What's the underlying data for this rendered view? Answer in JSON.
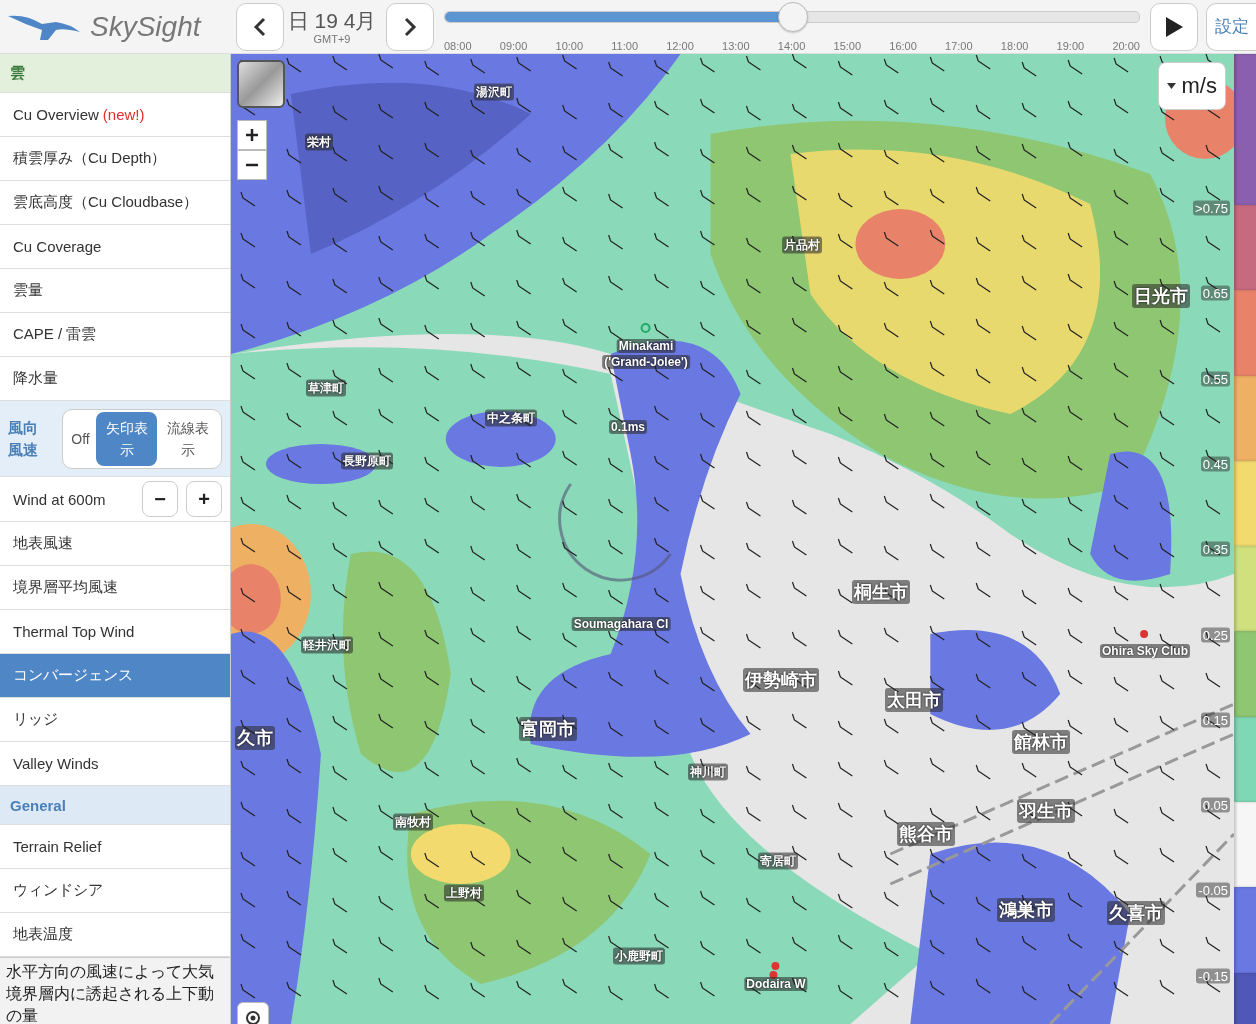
{
  "header": {
    "logo": "SkySight",
    "date": "日 19 4月",
    "timezone": "GMT+9",
    "settings": "設定",
    "timeline": {
      "level": 0.5,
      "ticks": [
        "08:00",
        "09:00",
        "10:00",
        "11:00",
        "12:00",
        "13:00",
        "14:00",
        "15:00",
        "16:00",
        "17:00",
        "18:00",
        "19:00",
        "20:00"
      ]
    }
  },
  "sidebar": {
    "items": [
      {
        "kind": "section",
        "label": "雲",
        "color": "#e2f0dc"
      },
      {
        "kind": "item",
        "label": "Cu Overview",
        "tag": "(new!)",
        "selected": false
      },
      {
        "kind": "item",
        "label": "積雲厚み（Cu Depth）",
        "selected": false
      },
      {
        "kind": "item",
        "label": "雲底高度（Cu Cloudbase）",
        "selected": false
      },
      {
        "kind": "item",
        "label": "Cu Coverage",
        "selected": false
      },
      {
        "kind": "item",
        "label": "雲量",
        "selected": false
      },
      {
        "kind": "item",
        "label": "CAPE / 雷雲",
        "selected": false
      },
      {
        "kind": "item",
        "label": "降水量",
        "selected": false
      },
      {
        "kind": "toggle",
        "label": "風向風速",
        "options": [
          {
            "label": "Off",
            "selected": false
          },
          {
            "label": "矢印表示",
            "selected": true
          },
          {
            "label": "流線表示",
            "selected": false
          }
        ]
      },
      {
        "kind": "stepper",
        "label": "Wind at 600m",
        "minus": "−",
        "plus": "+"
      },
      {
        "kind": "item",
        "label": "地表風速",
        "selected": false
      },
      {
        "kind": "item",
        "label": "境界層平均風速",
        "selected": false
      },
      {
        "kind": "item",
        "label": "Thermal Top Wind",
        "selected": false
      },
      {
        "kind": "item",
        "label": "コンバージェンス",
        "selected": true
      },
      {
        "kind": "item",
        "label": "リッジ",
        "selected": false
      },
      {
        "kind": "item",
        "label": "Valley Winds",
        "selected": false
      },
      {
        "kind": "section",
        "label": "General",
        "color": "#dde9f5"
      },
      {
        "kind": "item",
        "label": "Terrain Relief",
        "selected": false
      },
      {
        "kind": "item",
        "label": "ウィンドシア",
        "selected": false
      },
      {
        "kind": "item",
        "label": "地表温度",
        "selected": false
      }
    ],
    "description": "水平方向の風速によって大気境界層内に誘起される上下動の量"
  },
  "map": {
    "unit": "m/s",
    "labels": [
      {
        "kind": "town",
        "text": "湯沢町"
      },
      {
        "kind": "town",
        "text": "栄村"
      },
      {
        "kind": "town",
        "text": "片品村"
      },
      {
        "kind": "city",
        "text": "日光市"
      },
      {
        "kind": "town",
        "text": "Minakami"
      },
      {
        "kind": "town",
        "text": "('Grand-Jolee')"
      },
      {
        "kind": "town",
        "text": "草津町"
      },
      {
        "kind": "town",
        "text": "中之条町"
      },
      {
        "kind": "town",
        "text": "0.1ms"
      },
      {
        "kind": "town",
        "text": "長野原町"
      },
      {
        "kind": "city",
        "text": "桐生市"
      },
      {
        "kind": "city",
        "text": "伊勢崎市"
      },
      {
        "kind": "city",
        "text": "太田市"
      },
      {
        "kind": "city",
        "text": "館林市"
      },
      {
        "kind": "town",
        "text": "軽井沢町"
      },
      {
        "kind": "city",
        "text": "富岡市"
      },
      {
        "kind": "city",
        "text": "久市"
      },
      {
        "kind": "town",
        "text": "神川町"
      },
      {
        "kind": "city",
        "text": "羽生市"
      },
      {
        "kind": "city",
        "text": "熊谷市"
      },
      {
        "kind": "town",
        "text": "南牧村"
      },
      {
        "kind": "town",
        "text": "寄居町"
      },
      {
        "kind": "town",
        "text": "上野村"
      },
      {
        "kind": "city",
        "text": "鴻巣市"
      },
      {
        "kind": "city",
        "text": "久喜市"
      },
      {
        "kind": "town",
        "text": "小鹿野町"
      },
      {
        "kind": "town",
        "text": "Dodaira W"
      },
      {
        "kind": "town",
        "text": "Ohira Sky Club"
      },
      {
        "kind": "town",
        "text": "Soumagahara Cl"
      }
    ]
  },
  "legend": {
    "values": [
      ">0.75",
      "0.65",
      "0.55",
      "0.45",
      "0.35",
      "0.25",
      "0.15",
      "0.05",
      "-0.05",
      "-0.15"
    ],
    "bands": [
      {
        "color": "#8a5fb0"
      },
      {
        "color": "#c66a80"
      },
      {
        "color": "#e8836a"
      },
      {
        "color": "#eeb163"
      },
      {
        "color": "#f2da6f"
      },
      {
        "color": "#cfe07c"
      },
      {
        "color": "#8ec672"
      },
      {
        "color": "#7fd8b5"
      },
      {
        "color": "#f6f6f6"
      },
      {
        "color": "#6a78e2"
      },
      {
        "color": "#4f58b8"
      }
    ]
  }
}
